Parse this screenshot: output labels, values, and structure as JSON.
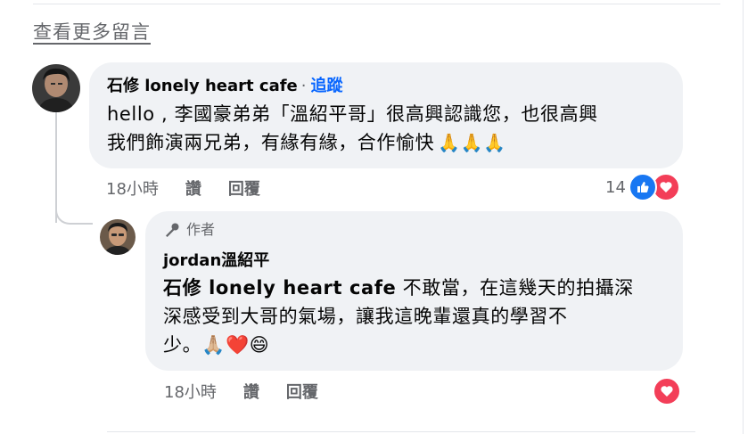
{
  "view_more_label": "查看更多留言",
  "comment": {
    "author": "石修 lonely heart cafe",
    "separator": "·",
    "follow_label": "追蹤",
    "text_line1": "hello , 李國豪弟弟「溫紹平哥」很高興認識您，也很高興",
    "text_line2": "我們飾演兩兄弟，有緣有緣，合作愉快",
    "emoji": "🙏🙏🙏",
    "time": "18小時",
    "like_label": "讚",
    "reply_label": "回覆",
    "reaction_count": "14",
    "reactions": [
      "like",
      "love"
    ]
  },
  "reply": {
    "badge_label": "作者",
    "author": "jordan溫紹平",
    "mention": "石修 lonely heart cafe",
    "text_part1": " 不敢當，在這幾天的拍攝深",
    "text_line2": "深感受到大哥的氣場，讓我這晚輩還真的學習不",
    "text_line3": "少。🙏🏼❤️😄",
    "time": "18小時",
    "like_label": "讚",
    "reply_label": "回覆",
    "reactions": [
      "love"
    ]
  },
  "colors": {
    "link_blue": "#0866ff",
    "like_blue": "#1877f2",
    "love_red": "#f33e58",
    "bubble_bg": "#f0f2f5",
    "meta_gray": "#65676b"
  },
  "icons": {
    "badge": "microphone-icon",
    "like": "thumbs-up-icon",
    "love": "heart-icon"
  }
}
